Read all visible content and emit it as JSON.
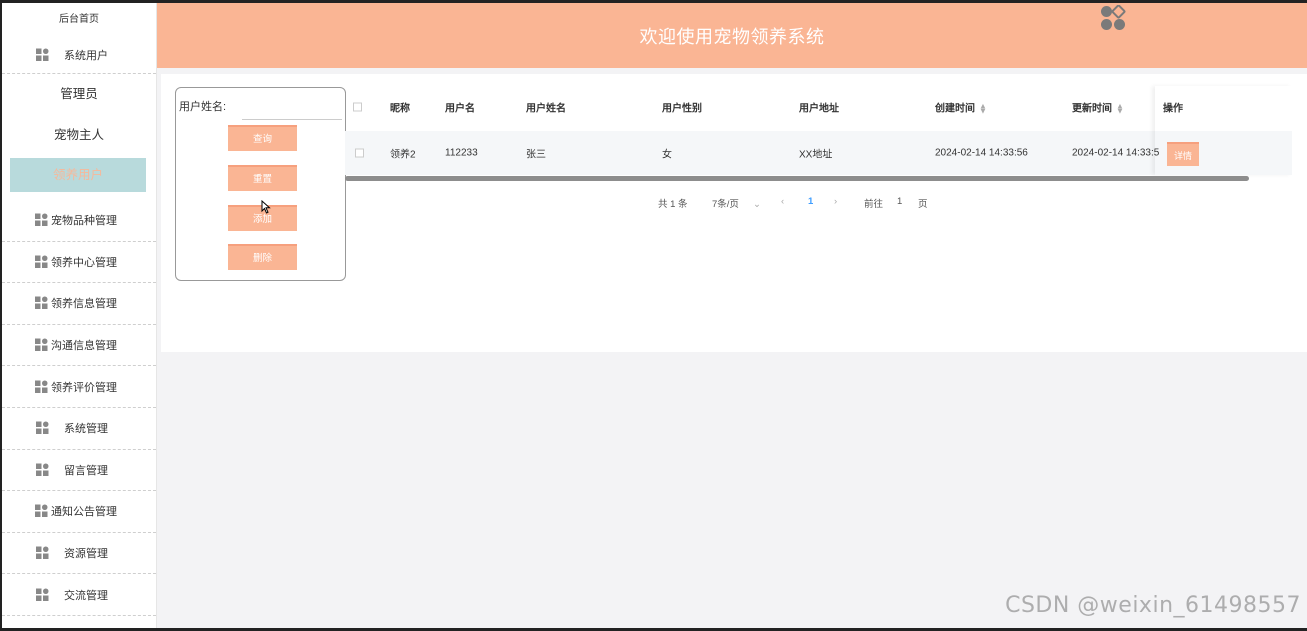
{
  "header": {
    "title": "欢迎使用宠物领养系统",
    "logo_icon": "clover-logo-icon"
  },
  "sidebar": {
    "home": "后台首页",
    "system_user": "系统用户",
    "sub_items": [
      {
        "label": "管理员",
        "active": false
      },
      {
        "label": "宠物主人",
        "active": false
      },
      {
        "label": "领养用户",
        "active": true
      }
    ],
    "items": [
      {
        "label": "宠物品种管理"
      },
      {
        "label": "领养中心管理"
      },
      {
        "label": "领养信息管理"
      },
      {
        "label": "沟通信息管理"
      },
      {
        "label": "领养评价管理"
      },
      {
        "label": "系统管理"
      },
      {
        "label": "留言管理"
      },
      {
        "label": "通知公告管理"
      },
      {
        "label": "资源管理"
      },
      {
        "label": "交流管理"
      }
    ]
  },
  "search": {
    "label": "用户姓名:",
    "value": "",
    "placeholder": "",
    "buttons": {
      "query": "查询",
      "reset": "重置",
      "add": "添加",
      "delete": "删除"
    }
  },
  "table": {
    "headers": {
      "nickname": "昵称",
      "username": "用户名",
      "realname": "用户姓名",
      "gender": "用户性别",
      "address": "用户地址",
      "created": "创建时间",
      "updated": "更新时间",
      "action": "操作"
    },
    "rows": [
      {
        "nickname": "领养2",
        "username": "112233",
        "realname": "张三",
        "gender": "女",
        "address": "XX地址",
        "created": "2024-02-14 14:33:56",
        "updated": "2024-02-14 14:33:5",
        "action": "详情"
      }
    ]
  },
  "pagination": {
    "total": "共 1 条",
    "page_size": "7条/页",
    "current_page": "1",
    "goto_label": "前往",
    "goto_value": "1",
    "page_suffix": "页"
  },
  "watermark": "CSDN @weixin_61498557",
  "colors": {
    "accent": "#fab594",
    "active_bg": "#b8dadc",
    "link": "#409eff"
  }
}
